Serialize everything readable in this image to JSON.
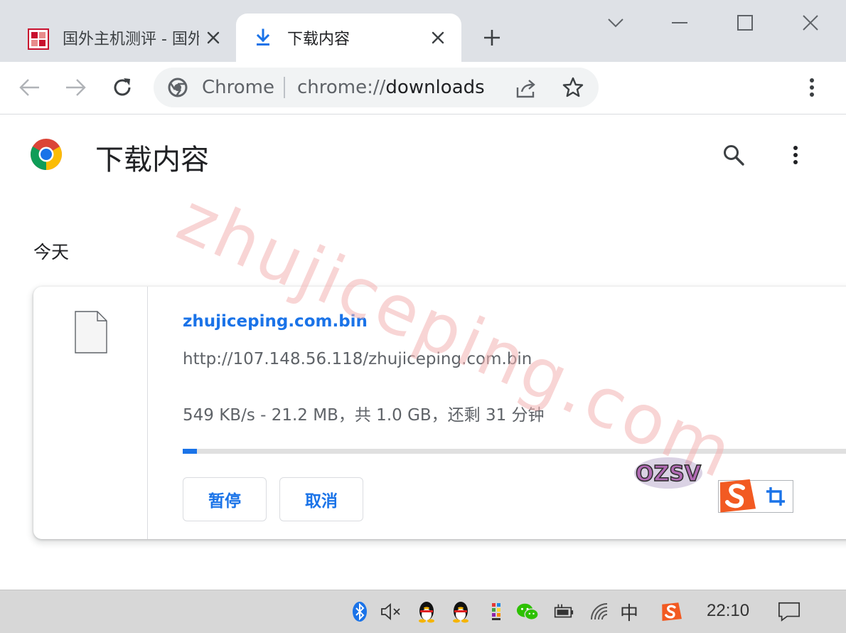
{
  "tabs": [
    {
      "title": "国外主机测评 - 国外VPS",
      "active": false
    },
    {
      "title": "下载内容",
      "active": true
    }
  ],
  "omnibox": {
    "chip": "Chrome",
    "url_scheme": "chrome://",
    "url_host": "downloads"
  },
  "page": {
    "title": "下载内容",
    "watermark": "zhujiceping.com"
  },
  "downloads": {
    "section_date": "今天",
    "items": [
      {
        "file_name": "zhujiceping.com.bin",
        "url": "http://107.148.56.118/zhujiceping.com.bin",
        "status": "549 KB/s - 21.2 MB，共 1.0 GB，还剩 31 分钟",
        "progress_fraction": 0.021,
        "pause_label": "暂停",
        "cancel_label": "取消"
      }
    ]
  },
  "overlay": {
    "sticker_text": "OZSV"
  },
  "taskbar": {
    "ime_lang": "中",
    "clock": "22:10"
  },
  "colors": {
    "accent": "#1a73e8",
    "tabstrip": "#dee1e6",
    "watermark": "#f4b4b4",
    "sogou": "#f25a22"
  }
}
